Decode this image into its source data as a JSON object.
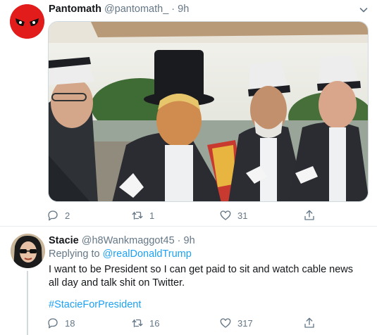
{
  "tweets": [
    {
      "author": {
        "name": "Pantomath",
        "handle": "@pantomath_",
        "time": "9h"
      },
      "stats": {
        "replies": "2",
        "retweets": "1",
        "likes": "31"
      }
    },
    {
      "author": {
        "name": "Stacie",
        "handle": "@h8Wankmaggot45",
        "time": "9h"
      },
      "reply": {
        "prefix": "Replying to",
        "mention": "@realDonaldTrump"
      },
      "text": "I want to be President so I can get paid to sit and watch cable news all day and talk shit on Twitter.",
      "hashtag": "#StacieForPresident",
      "stats": {
        "replies": "18",
        "retweets": "16",
        "likes": "317"
      }
    }
  ],
  "ui": {
    "separator": "·"
  },
  "colors": {
    "link": "#1da1f2",
    "muted": "#657786",
    "text": "#14171a"
  }
}
